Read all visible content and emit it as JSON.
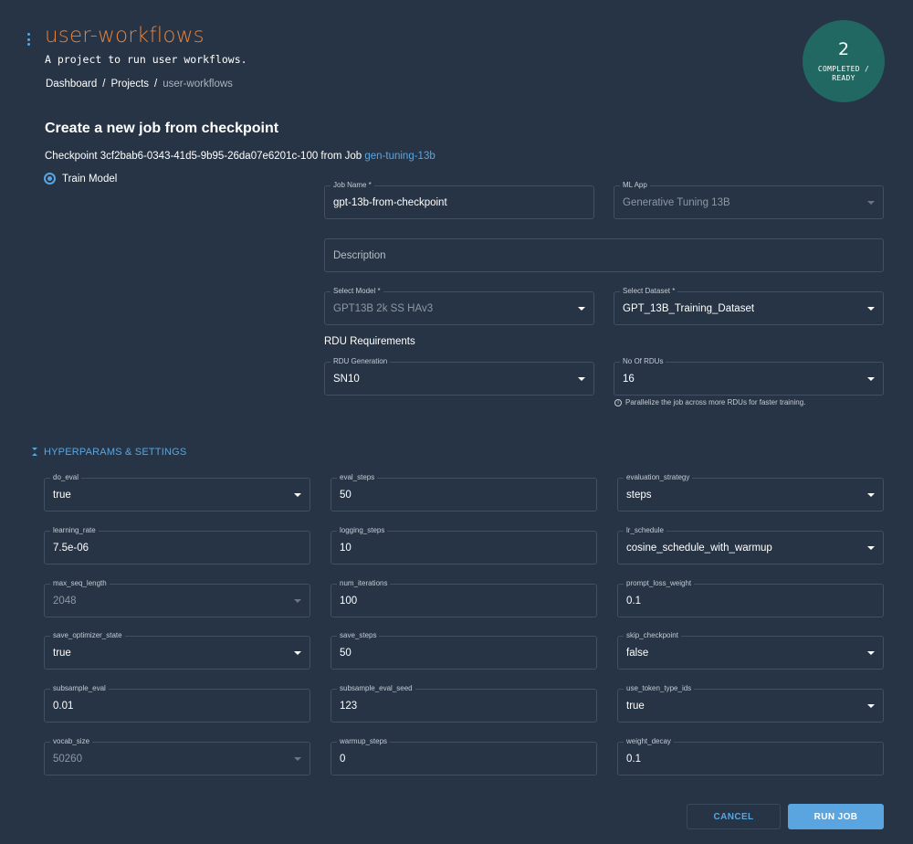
{
  "header": {
    "menu_icon": "kebab-vertical-icon",
    "project_title": "user-workflows",
    "project_description": "A project to run user workflows.",
    "breadcrumb": [
      {
        "label": "Dashboard"
      },
      {
        "label": "Projects"
      },
      {
        "label": "user-workflows"
      }
    ],
    "breadcrumb_separator": "/",
    "status": {
      "count": "2",
      "label": "COMPLETED / READY",
      "color": "#216862"
    }
  },
  "form": {
    "title": "Create a new job from checkpoint",
    "checkpoint_prefix": "Checkpoint 3cf2bab6-0343-41d5-9b95-26da07e6201c-100 from Job ",
    "checkpoint_job_link": "gen-tuning-13b",
    "task_option": {
      "label": "Train Model",
      "selected": true
    },
    "job_name": {
      "label": "Job Name *",
      "value": "gpt-13b-from-checkpoint"
    },
    "ml_app": {
      "label": "ML App",
      "value": "Generative Tuning 13B",
      "disabled": true
    },
    "description": {
      "placeholder": "Description",
      "value": ""
    },
    "select_model": {
      "label": "Select Model *",
      "value": "GPT13B 2k SS HAv3",
      "disabled": true
    },
    "select_dataset": {
      "label": "Select Dataset *",
      "value": "GPT_13B_Training_Dataset"
    },
    "rdu_requirements_title": "RDU Requirements",
    "rdu_generation": {
      "label": "RDU Generation",
      "value": "SN10"
    },
    "num_rdus": {
      "label": "No Of RDUs",
      "value": "16"
    },
    "rdu_helper_text": "Parallelize the job across more RDUs for faster training.",
    "info_icon": "info-circle-icon"
  },
  "hyperparams": {
    "section_label": "HYPERPARAMS & SETTINGS",
    "toggle_icon": "collapse-arrows-icon",
    "fields": [
      {
        "label": "do_eval",
        "value": "true",
        "type": "select"
      },
      {
        "label": "eval_steps",
        "value": "50",
        "type": "text"
      },
      {
        "label": "evaluation_strategy",
        "value": "steps",
        "type": "select"
      },
      {
        "label": "learning_rate",
        "value": "7.5e-06",
        "type": "text"
      },
      {
        "label": "logging_steps",
        "value": "10",
        "type": "text"
      },
      {
        "label": "lr_schedule",
        "value": "cosine_schedule_with_warmup",
        "type": "select"
      },
      {
        "label": "max_seq_length",
        "value": "2048",
        "type": "select",
        "disabled": true
      },
      {
        "label": "num_iterations",
        "value": "100",
        "type": "text"
      },
      {
        "label": "prompt_loss_weight",
        "value": "0.1",
        "type": "text"
      },
      {
        "label": "save_optimizer_state",
        "value": "true",
        "type": "select"
      },
      {
        "label": "save_steps",
        "value": "50",
        "type": "text"
      },
      {
        "label": "skip_checkpoint",
        "value": "false",
        "type": "select"
      },
      {
        "label": "subsample_eval",
        "value": "0.01",
        "type": "text"
      },
      {
        "label": "subsample_eval_seed",
        "value": "123",
        "type": "text"
      },
      {
        "label": "use_token_type_ids",
        "value": "true",
        "type": "select"
      },
      {
        "label": "vocab_size",
        "value": "50260",
        "type": "select",
        "disabled": true
      },
      {
        "label": "warmup_steps",
        "value": "0",
        "type": "text"
      },
      {
        "label": "weight_decay",
        "value": "0.1",
        "type": "text"
      }
    ]
  },
  "actions": {
    "cancel_label": "CANCEL",
    "run_label": "RUN JOB",
    "accent_color": "#5aa5e0"
  }
}
